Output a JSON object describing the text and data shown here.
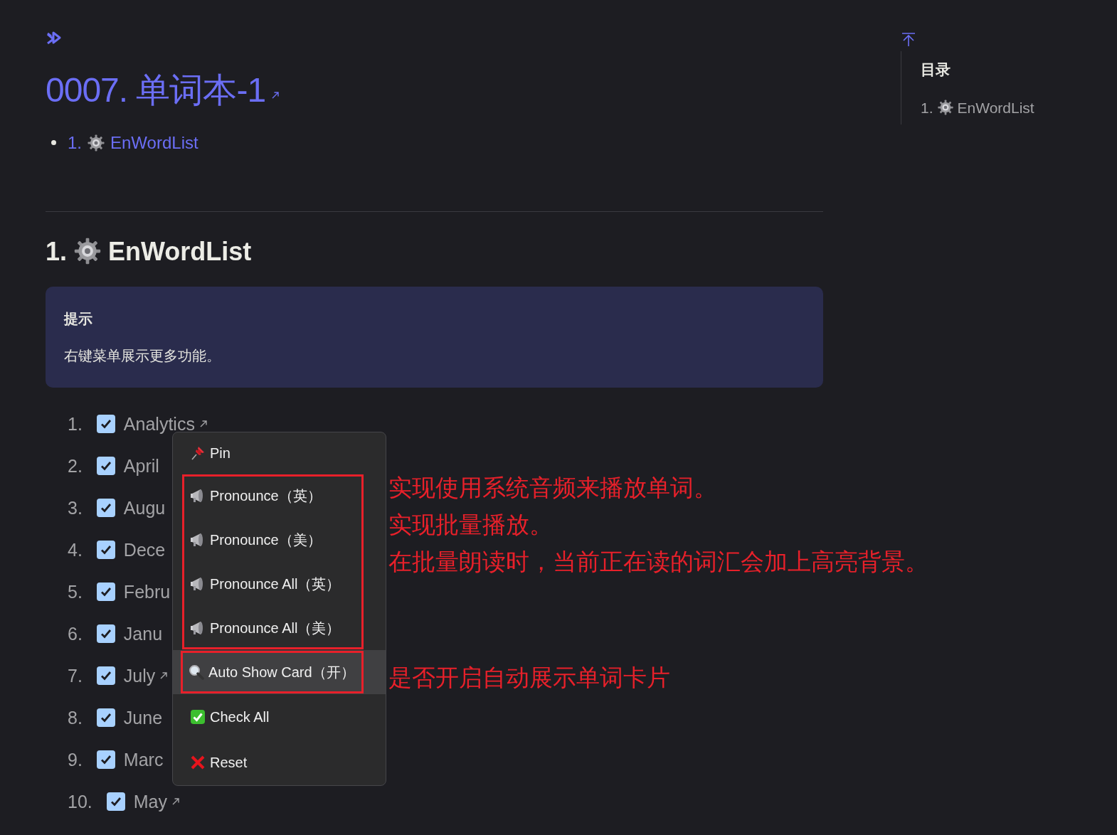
{
  "title": "0007. 单词本-1",
  "toc_links": [
    {
      "number": "1.",
      "label": "EnWordList"
    }
  ],
  "heading": {
    "number": "1.",
    "label": "EnWordList"
  },
  "callout": {
    "title": "提示",
    "text": "右键菜单展示更多功能。"
  },
  "words": [
    {
      "number": "1.",
      "word": "Analytics",
      "checked": true,
      "link_arrow": true
    },
    {
      "number": "2.",
      "word": "April",
      "checked": true,
      "link_arrow": false
    },
    {
      "number": "3.",
      "word": "Augu",
      "checked": true,
      "link_arrow": false
    },
    {
      "number": "4.",
      "word": "Dece",
      "checked": true,
      "link_arrow": false
    },
    {
      "number": "5.",
      "word": "Febru",
      "checked": true,
      "link_arrow": false
    },
    {
      "number": "6.",
      "word": "Janu",
      "checked": true,
      "link_arrow": false
    },
    {
      "number": "7.",
      "word": "July",
      "checked": true,
      "link_arrow": true
    },
    {
      "number": "8.",
      "word": "June",
      "checked": true,
      "link_arrow": false
    },
    {
      "number": "9.",
      "word": "Marc",
      "checked": true,
      "link_arrow": false
    },
    {
      "number": "10.",
      "word": "May",
      "checked": true,
      "link_arrow": true
    }
  ],
  "context_menu": [
    {
      "outlined": false,
      "items": [
        {
          "kind": "pin",
          "label": "Pin",
          "highlighted": false
        }
      ]
    },
    {
      "outlined": true,
      "items": [
        {
          "kind": "speaker",
          "label": "Pronounce（英）",
          "highlighted": false
        },
        {
          "kind": "speaker",
          "label": "Pronounce（美）",
          "highlighted": false
        },
        {
          "kind": "speaker",
          "label": "Pronounce All（英）",
          "highlighted": false
        },
        {
          "kind": "speaker",
          "label": "Pronounce All（美）",
          "highlighted": false
        }
      ]
    },
    {
      "outlined": true,
      "items": [
        {
          "kind": "search",
          "label": "Auto Show Card（开）",
          "highlighted": true
        }
      ]
    },
    {
      "outlined": false,
      "items": [
        {
          "kind": "check",
          "label": "Check All",
          "highlighted": false
        },
        {
          "kind": "cross",
          "label": "Reset",
          "highlighted": false
        }
      ]
    }
  ],
  "annotations": [
    {
      "lines": [
        "实现使用系统音频来播放单词。",
        "实现批量播放。",
        "在批量朗读时，当前正在读的词汇会加上高亮背景。"
      ]
    },
    {
      "lines": [
        "是否开启自动展示单词卡片"
      ]
    }
  ],
  "outline": {
    "title": "目录",
    "items": [
      {
        "number": "1.",
        "label": "EnWordList"
      }
    ]
  }
}
